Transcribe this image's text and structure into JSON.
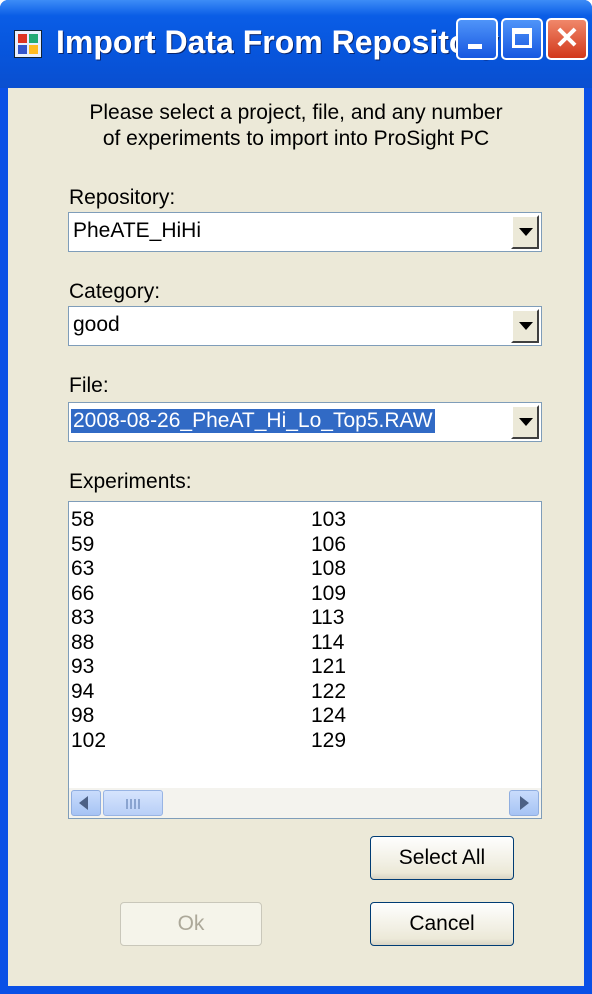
{
  "window": {
    "title": "Import Data From Repository",
    "controls": {
      "minimize": "minimize-icon",
      "maximize": "maximize-icon",
      "close": "close-icon"
    }
  },
  "instructions": "Please select a project, file, and any number of experiments to import into ProSight PC",
  "repository": {
    "label": "Repository:",
    "value": "PheATE_HiHi"
  },
  "category": {
    "label": "Category:",
    "value": "good"
  },
  "file": {
    "label": "File:",
    "value": "2008-08-26_PheAT_Hi_Lo_Top5.RAW"
  },
  "experiments": {
    "label": "Experiments:",
    "column1": [
      "58",
      "59",
      "63",
      "66",
      "83",
      "88",
      "93",
      "94",
      "98",
      "102"
    ],
    "column2": [
      "103",
      "106",
      "108",
      "109",
      "113",
      "114",
      "121",
      "122",
      "124",
      "129"
    ]
  },
  "buttons": {
    "select_all": "Select All",
    "ok": "Ok",
    "cancel": "Cancel"
  },
  "colors": {
    "titlebar": "#0a5de6",
    "client": "#ece9d8",
    "selection": "#316ac5",
    "close": "#d2381b"
  }
}
